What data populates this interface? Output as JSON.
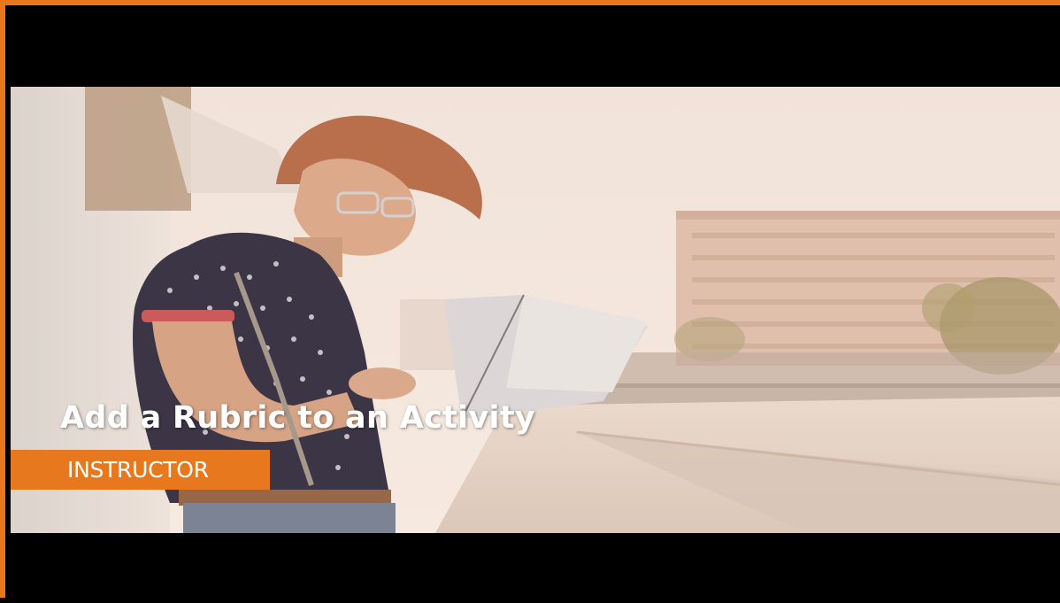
{
  "video": {
    "title": "Add a Rubric to an Activity",
    "role_badge": "INSTRUCTOR"
  },
  "colors": {
    "accent": "#e8781e",
    "letterbox": "#000000",
    "title_text": "#ffffff"
  },
  "scene": {
    "icons": [
      "person-with-laptop-illustration",
      "building-illustration"
    ]
  }
}
